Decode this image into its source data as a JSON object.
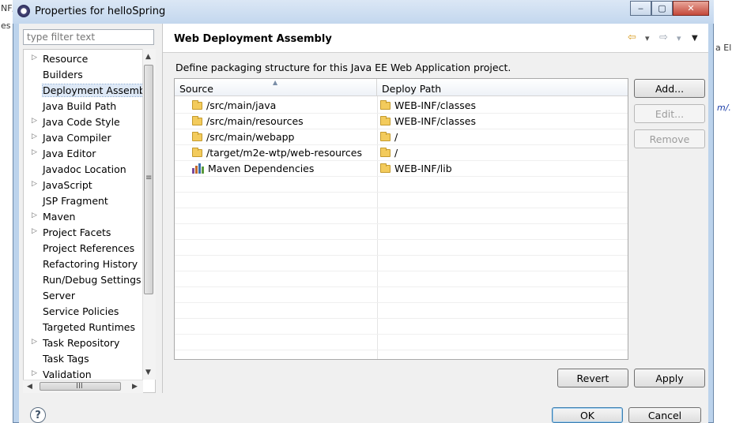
{
  "background": {
    "left_fragments": [
      "NF/",
      "es"
    ],
    "right_fragments": [
      "a El",
      "m/."
    ]
  },
  "window": {
    "title": "Properties for helloSpring",
    "controls": {
      "minimize": "‒",
      "maximize": "▢",
      "close": "✕"
    }
  },
  "filter": {
    "placeholder": "type filter text"
  },
  "tree": {
    "items": [
      {
        "label": "Resource",
        "expandable": true
      },
      {
        "label": "Builders",
        "expandable": false
      },
      {
        "label": "Deployment Assembly",
        "expandable": false,
        "selected": true
      },
      {
        "label": "Java Build Path",
        "expandable": false
      },
      {
        "label": "Java Code Style",
        "expandable": true
      },
      {
        "label": "Java Compiler",
        "expandable": true
      },
      {
        "label": "Java Editor",
        "expandable": true
      },
      {
        "label": "Javadoc Location",
        "expandable": false
      },
      {
        "label": "JavaScript",
        "expandable": true
      },
      {
        "label": "JSP Fragment",
        "expandable": false
      },
      {
        "label": "Maven",
        "expandable": true
      },
      {
        "label": "Project Facets",
        "expandable": true
      },
      {
        "label": "Project References",
        "expandable": false
      },
      {
        "label": "Refactoring History",
        "expandable": false
      },
      {
        "label": "Run/Debug Settings",
        "expandable": false
      },
      {
        "label": "Server",
        "expandable": false
      },
      {
        "label": "Service Policies",
        "expandable": false
      },
      {
        "label": "Targeted Runtimes",
        "expandable": false
      },
      {
        "label": "Task Repository",
        "expandable": true
      },
      {
        "label": "Task Tags",
        "expandable": false
      },
      {
        "label": "Validation",
        "expandable": true
      }
    ],
    "scroll": {
      "up": "▲",
      "down": "▼",
      "left": "◀",
      "right": "▶",
      "vgrip": "≡",
      "hgrip": "III"
    }
  },
  "page": {
    "title": "Web Deployment Assembly",
    "nav": {
      "back": "⇦",
      "back_menu": "▾",
      "forward": "⇨",
      "forward_menu": "▾",
      "view_menu": "▼"
    },
    "description": "Define packaging structure for this Java EE Web Application project."
  },
  "table": {
    "columns": {
      "source": "Source",
      "deploy_path": "Deploy Path"
    },
    "sort_indicator": "▲",
    "rows": [
      {
        "source": "/src/main/java",
        "deploy_path": "WEB-INF/classes",
        "icon": "folder-icon"
      },
      {
        "source": "/src/main/resources",
        "deploy_path": "WEB-INF/classes",
        "icon": "folder-icon"
      },
      {
        "source": "/src/main/webapp",
        "deploy_path": "/",
        "icon": "folder-icon"
      },
      {
        "source": "/target/m2e-wtp/web-resources",
        "deploy_path": "/",
        "icon": "folder-icon"
      },
      {
        "source": "Maven Dependencies",
        "deploy_path": "WEB-INF/lib",
        "icon": "library-icon"
      }
    ],
    "empty_rows": 11
  },
  "buttons": {
    "add": "Add...",
    "edit": "Edit...",
    "remove": "Remove",
    "revert": "Revert",
    "apply": "Apply",
    "ok": "OK",
    "cancel": "Cancel",
    "help": "?"
  }
}
